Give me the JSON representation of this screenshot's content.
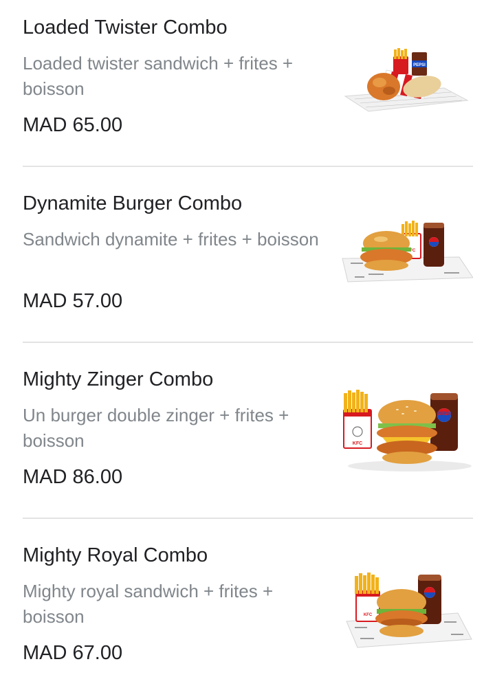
{
  "menu": {
    "items": [
      {
        "name": "Loaded Twister Combo",
        "description": "Loaded twister sandwich + frites + boisson",
        "price": "MAD 65.00",
        "image": "twister-combo-photo"
      },
      {
        "name": "Dynamite Burger Combo",
        "description": "Sandwich dynamite + frites + boisson",
        "price": "MAD 57.00",
        "image": "dynamite-burger-combo-photo"
      },
      {
        "name": "Mighty Zinger Combo",
        "description": "Un burger double zinger + frites + boisson",
        "price": "MAD 86.00",
        "image": "mighty-zinger-combo-photo"
      },
      {
        "name": "Mighty Royal Combo",
        "description": "Mighty royal sandwich + frites + boisson",
        "price": "MAD 67.00",
        "image": "mighty-royal-combo-photo"
      }
    ],
    "image_texts": {
      "brand_kfc": "KFC",
      "brand_drink": "PEPSI"
    },
    "colors": {
      "title": "#202124",
      "description": "#80868b",
      "divider": "#e3e3e3",
      "kfc_red": "#d71920",
      "fries": "#f2b21a",
      "cola": "#6b2a14",
      "chicken": "#d9782a"
    }
  }
}
